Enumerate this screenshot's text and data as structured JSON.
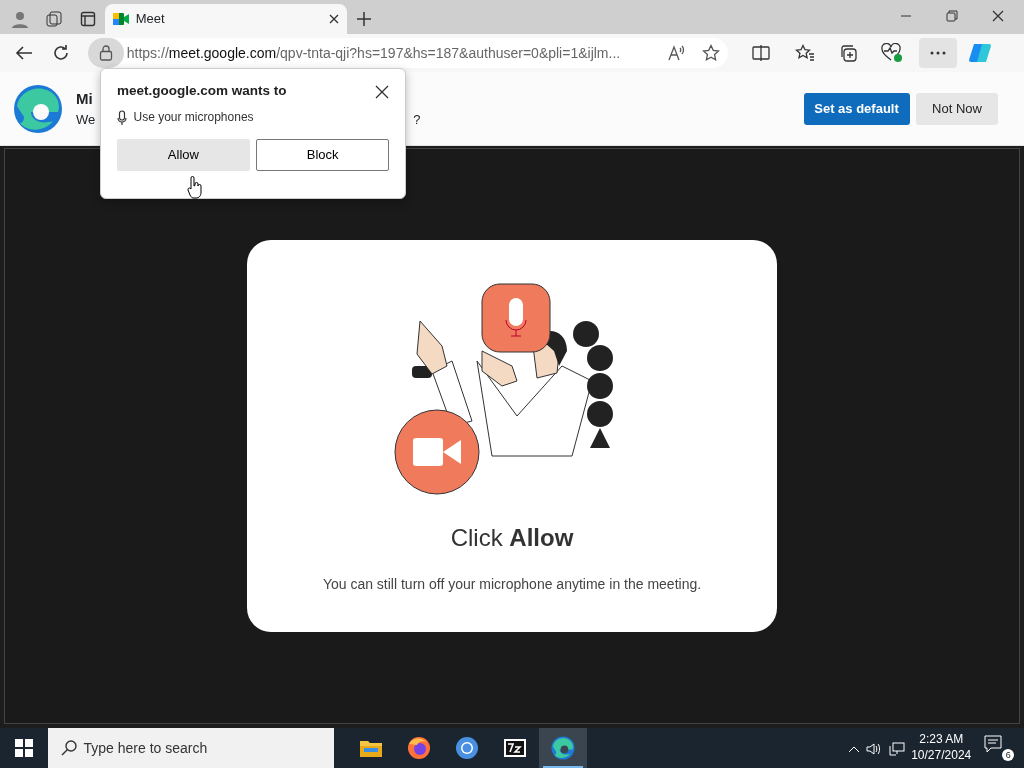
{
  "tabs": [
    {
      "title": "Meet",
      "selected": true
    }
  ],
  "address": {
    "scheme": "https://",
    "host": "meet.google.com",
    "path": "/qpv-tnta-qji?hs=197&hs=187&authuser=0&pli=1&ijlm..."
  },
  "infobar": {
    "title": "Mi",
    "text": "We",
    "text_end": "?",
    "buttons": [
      {
        "label": "Set as default",
        "kind": "primary"
      },
      {
        "label": "Not Now",
        "kind": "secondary"
      }
    ]
  },
  "permission_popup": {
    "title": "meet.google.com wants to",
    "permission": "Use your microphones",
    "buttons": [
      {
        "label": "Allow",
        "hovered": true
      },
      {
        "label": "Block",
        "hovered": false
      }
    ]
  },
  "card": {
    "heading": "Click **Allow**",
    "text": "You can still turn off your microphone anytime in the meeting."
  },
  "taskbar": {
    "search_placeholder": "Type here to search",
    "apps": [
      {
        "kind": "files",
        "active": false
      },
      {
        "kind": "firefox",
        "active": false
      },
      {
        "kind": "chrome",
        "active": false
      },
      {
        "kind": "archiver",
        "active": false
      },
      {
        "kind": "edge",
        "active": true
      }
    ],
    "time": "2:23 AM",
    "date": "10/27/2024",
    "notifications": "6"
  }
}
